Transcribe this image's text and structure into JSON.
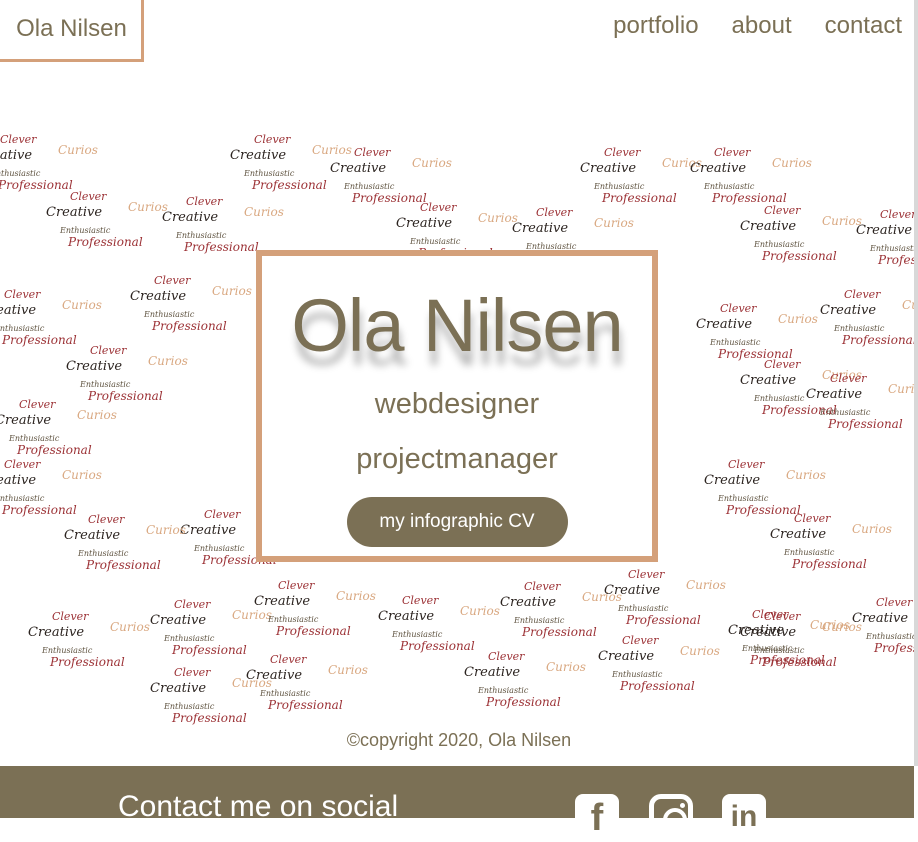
{
  "header": {
    "logo_text": "Ola Nilsen",
    "nav": [
      {
        "label": "portfolio"
      },
      {
        "label": "about"
      },
      {
        "label": "contact"
      }
    ]
  },
  "background_words": {
    "clever": "Clever",
    "curios": "Curios",
    "creative": "Creative",
    "enthusiastic": "Enthusiastic",
    "professional": "Professional"
  },
  "hero": {
    "name": "Ola Nilsen",
    "role1": "webdesigner",
    "role2": "projectmanager",
    "cv_button": "my infographic CV"
  },
  "copyright": "©copyright 2020, Ola Nilsen",
  "footer": {
    "social_title": "Contact me on social",
    "icons": [
      "facebook-icon",
      "instagram-icon",
      "linkedin-icon"
    ]
  },
  "colors": {
    "accent_brown": "#7b7055",
    "border_tan": "#d4a07a",
    "word_red": "#9c3236",
    "word_peach": "#d9a881"
  }
}
